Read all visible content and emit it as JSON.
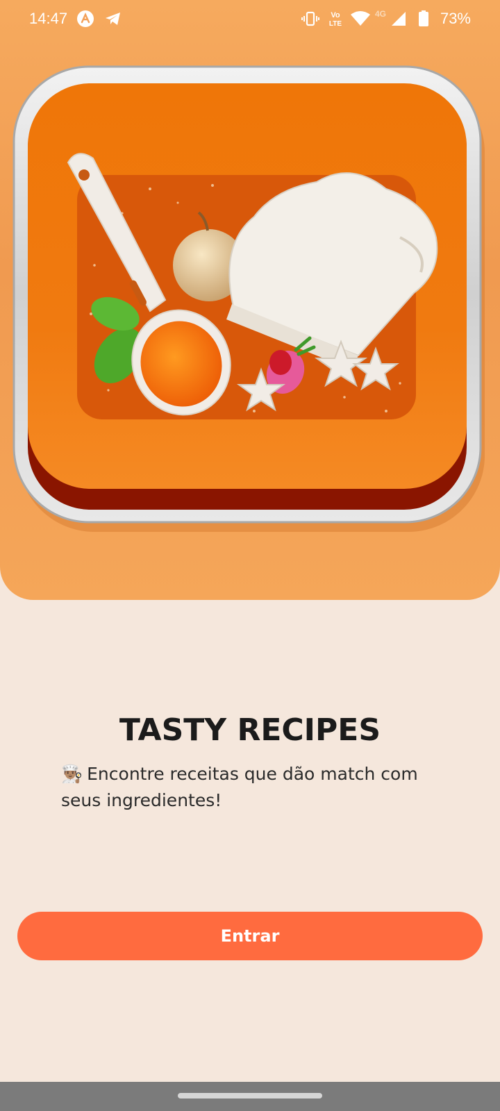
{
  "status_bar": {
    "time": "14:47",
    "battery": "73%",
    "icons": [
      "app-a-icon",
      "telegram-icon",
      "vibrate-icon",
      "volte-icon",
      "wifi-icon",
      "signal-4g-icon",
      "battery-icon"
    ],
    "network_label": "4G",
    "volte_label": "Vo LTE"
  },
  "hero": {
    "logo": "tasty-recipes-app-logo",
    "background_color": "#f39f55"
  },
  "content": {
    "title": "TASTY RECIPES",
    "subtitle_emoji": "👨🏽‍🍳",
    "subtitle": "Encontre receitas que dão match com seus ingredientes!"
  },
  "actions": {
    "enter_label": "Entrar",
    "enter_color": "#ff6b3f"
  },
  "page_background": "#f5e7dc"
}
